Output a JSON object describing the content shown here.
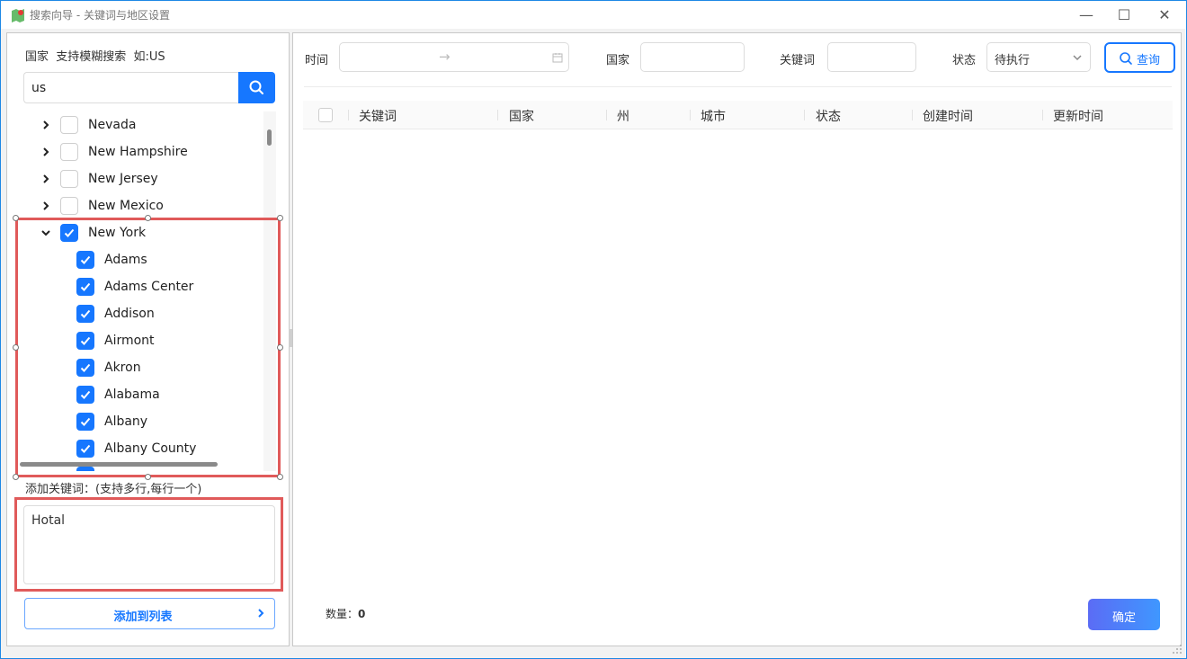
{
  "window": {
    "title": "搜索向导 - 关键词与地区设置",
    "icon": "map-app-icon",
    "controls": {
      "minimize": "—",
      "maximize": "☐",
      "close": "✕"
    }
  },
  "left": {
    "hint": "国家  支持模糊搜索  如:US",
    "search_value": "us",
    "search_icon": "search-icon",
    "tree": [
      {
        "label": "Nevada",
        "checked": false,
        "expanded": false,
        "level": 0
      },
      {
        "label": "New Hampshire",
        "checked": false,
        "expanded": false,
        "level": 0
      },
      {
        "label": "New Jersey",
        "checked": false,
        "expanded": false,
        "level": 0
      },
      {
        "label": "New Mexico",
        "checked": false,
        "expanded": false,
        "level": 0
      },
      {
        "label": "New York",
        "checked": true,
        "expanded": true,
        "level": 0
      },
      {
        "label": "Adams",
        "checked": true,
        "level": 1
      },
      {
        "label": "Adams Center",
        "checked": true,
        "level": 1
      },
      {
        "label": "Addison",
        "checked": true,
        "level": 1
      },
      {
        "label": "Airmont",
        "checked": true,
        "level": 1
      },
      {
        "label": "Akron",
        "checked": true,
        "level": 1
      },
      {
        "label": "Alabama",
        "checked": true,
        "level": 1
      },
      {
        "label": "Albany",
        "checked": true,
        "level": 1
      },
      {
        "label": "Albany County",
        "checked": true,
        "level": 1
      }
    ],
    "keyword_label": "添加关键词：(支持多行,每行一个)",
    "keyword_value": "Hotal",
    "add_button": "添加到列表",
    "highlight_color": "#e05a5a"
  },
  "filters": {
    "time_label": "时间",
    "time_arrow": "→",
    "country_label": "国家",
    "country_value": "",
    "keyword_label": "关键词",
    "keyword_value": "",
    "status_label": "状态",
    "status_value": "待执行",
    "query_button": "查询"
  },
  "table": {
    "columns": [
      "关键词",
      "国家",
      "州",
      "城市",
      "状态",
      "创建时间",
      "更新时间"
    ],
    "rows": []
  },
  "footer": {
    "count_label": "数量：",
    "count_value": "0",
    "confirm_button": "确定"
  },
  "colors": {
    "accent": "#1677ff",
    "window_border": "#1e88e5"
  }
}
